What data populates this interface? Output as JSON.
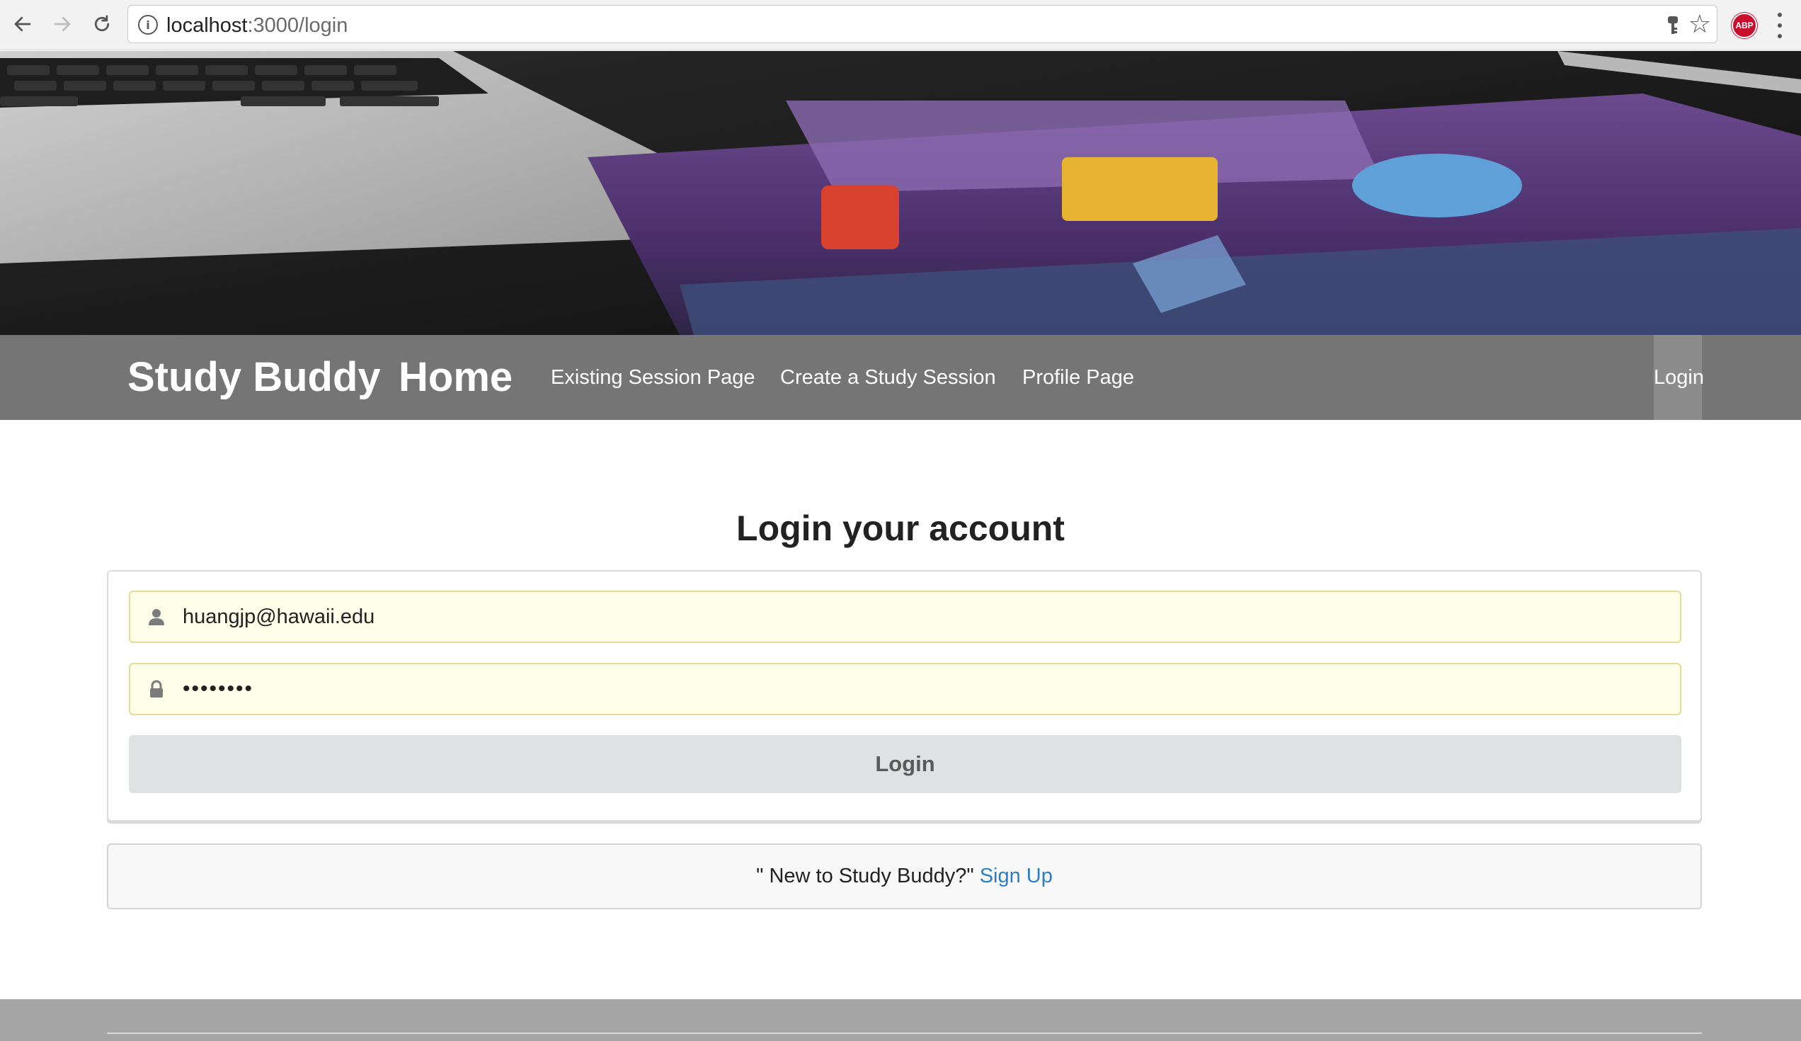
{
  "browser": {
    "url_host": "localhost",
    "url_path": ":3000/login",
    "extension_badge": "ABP",
    "icons": [
      "back-arrow-icon",
      "forward-arrow-icon",
      "reload-icon",
      "info-icon",
      "key-icon",
      "star-icon",
      "adblock-icon",
      "menu-kebab-icon"
    ]
  },
  "navbar": {
    "brand": "Study Buddy",
    "home": "Home",
    "links": [
      "Existing Session Page",
      "Create a Study Session",
      "Profile Page"
    ],
    "login": "Login"
  },
  "login": {
    "heading": "Login your account",
    "email_value": "huangjp@hawaii.edu",
    "password_mask": "••••••••",
    "submit_label": "Login",
    "icons": [
      "user-icon",
      "lock-icon"
    ]
  },
  "signup": {
    "prompt": "\" New to Study Buddy?\"",
    "link": "Sign Up"
  },
  "colors": {
    "navbar_bg": "#757575",
    "field_autofill_bg": "#fefee8",
    "link": "#2c7fc4",
    "footer_bg": "#a5a5a5"
  }
}
